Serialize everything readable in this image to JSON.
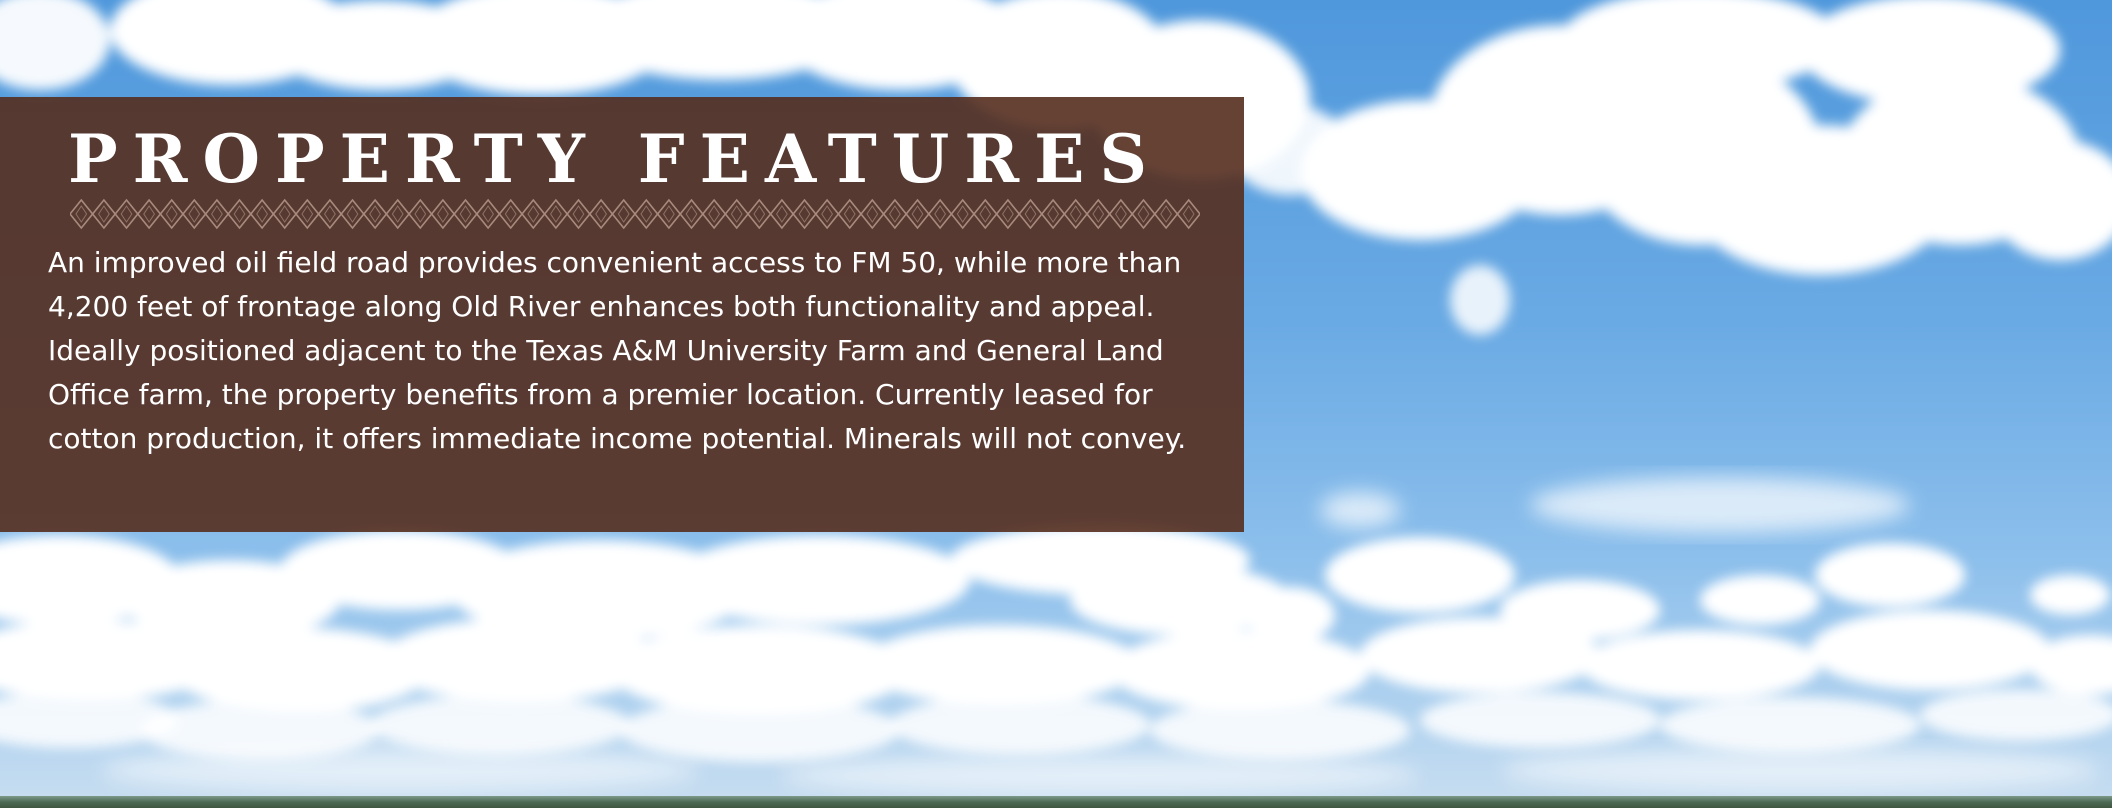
{
  "panel": {
    "title": "PROPERTY FEATURES",
    "body": "An improved oil field road provides convenient access to FM 50, while more than 4,200 feet of frontage along Old River enhances both functionality and appeal. Ideally positioned adjacent to the Texas A&M University Farm and General Land Office farm, the property benefits from a premier location. Currently leased for cotton production, it offers immediate income potential. Minerals will not convey."
  },
  "colors": {
    "panel_brown": "#552e1e",
    "ornament": "#a98a7c",
    "text": "#ffffff",
    "sky": "#5fa2e0"
  }
}
